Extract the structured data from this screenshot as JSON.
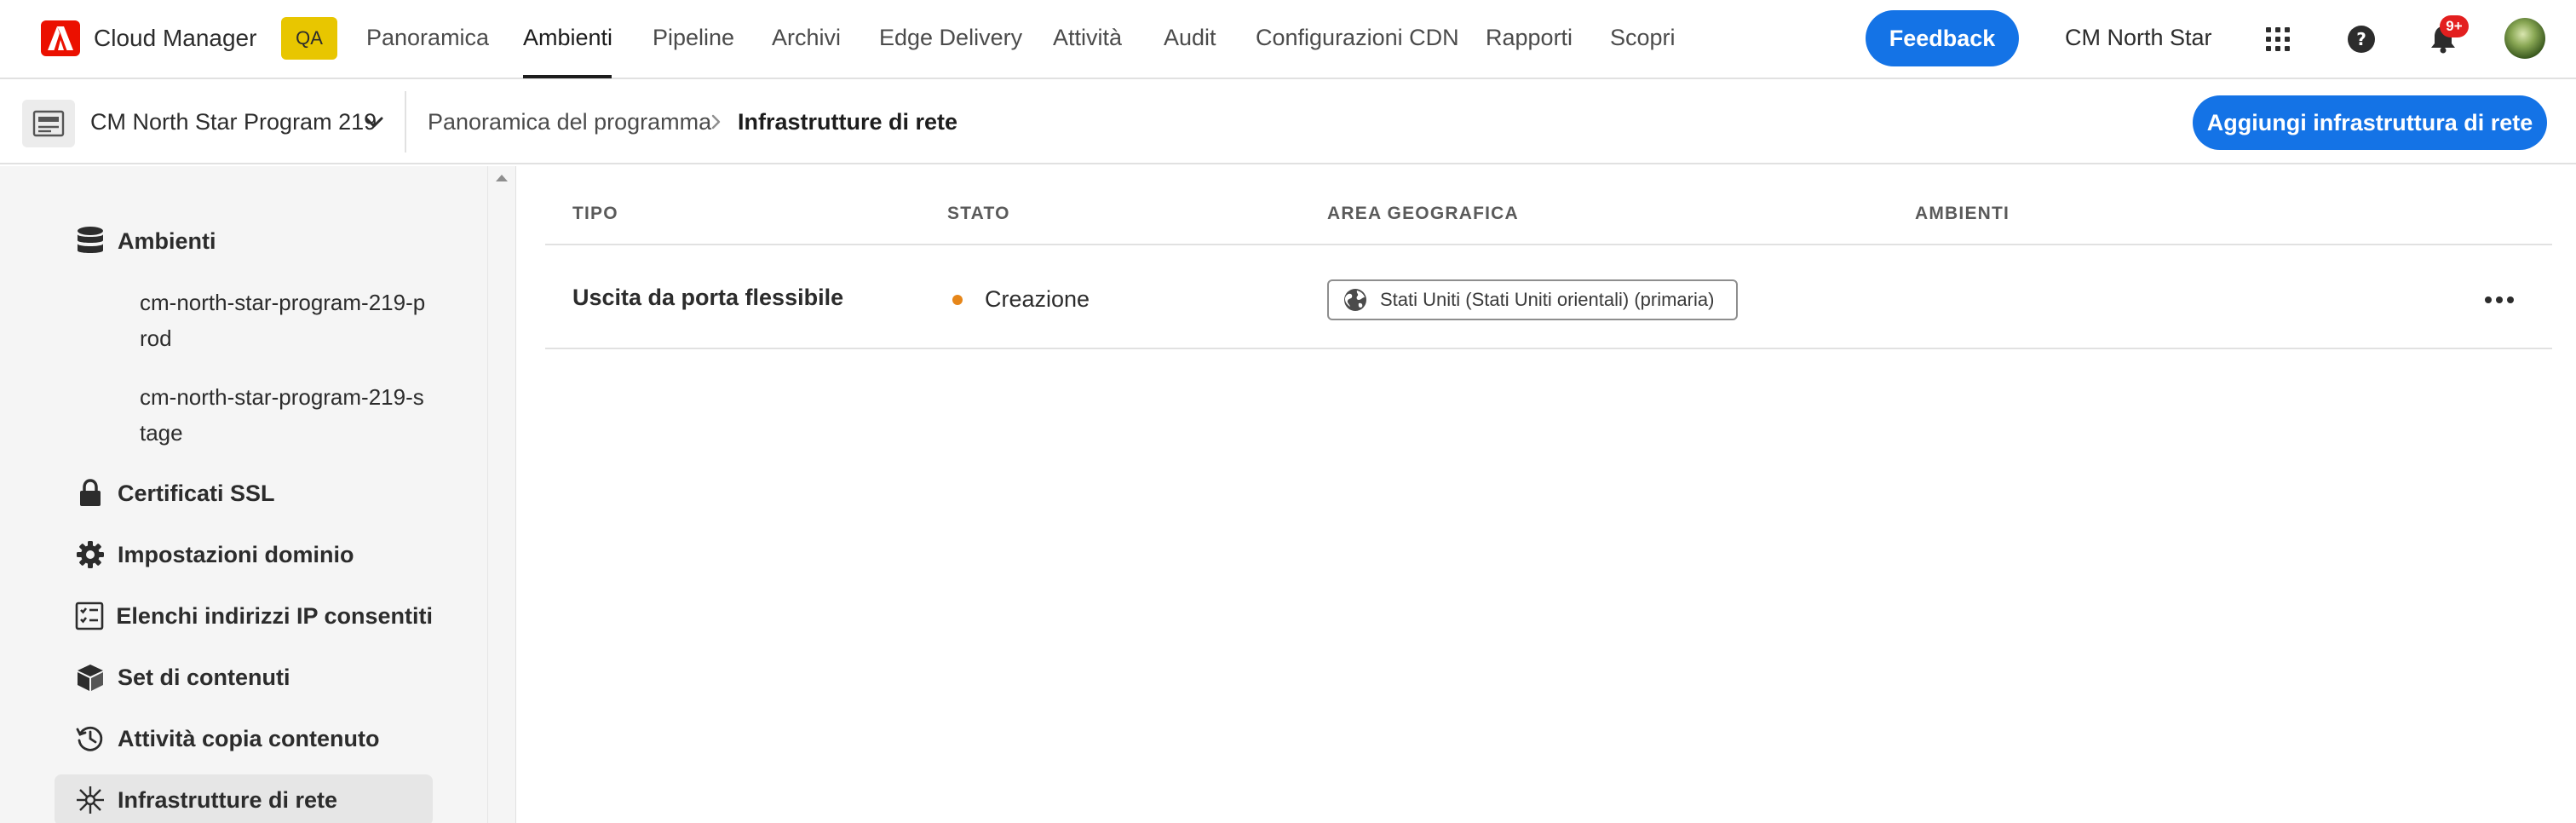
{
  "topnav": {
    "brand": "Cloud Manager",
    "env_badge": "QA",
    "items": [
      {
        "label": "Panoramica"
      },
      {
        "label": "Ambienti",
        "active": true
      },
      {
        "label": "Pipeline"
      },
      {
        "label": "Archivi"
      },
      {
        "label": "Edge Delivery"
      },
      {
        "label": "Attività"
      },
      {
        "label": "Audit"
      },
      {
        "label": "Configurazioni CDN"
      },
      {
        "label": "Rapporti"
      },
      {
        "label": "Scopri"
      }
    ],
    "feedback_label": "Feedback",
    "org_name": "CM North Star",
    "notification_count": "9+",
    "icons": [
      "adobe-logo",
      "app-switcher-icon",
      "help-icon",
      "bell-icon",
      "avatar"
    ]
  },
  "subheader": {
    "program_name": "CM North Star Program 219",
    "breadcrumb": [
      "Panoramica del programma",
      "Infrastrutture di rete"
    ],
    "add_button_label": "Aggiungi infrastruttura di rete"
  },
  "sidebar": {
    "environments_label": "Ambienti",
    "environments": [
      "cm-north-star-program-219-prod",
      "cm-north-star-program-219-stage"
    ],
    "items": [
      {
        "label": "Certificati SSL",
        "icon": "lock-icon"
      },
      {
        "label": "Impostazioni dominio",
        "icon": "gear-icon"
      },
      {
        "label": "Elenchi indirizzi IP consentiti",
        "icon": "checklist-icon"
      },
      {
        "label": "Set di contenuti",
        "icon": "box-icon"
      },
      {
        "label": "Attività copia contenuto",
        "icon": "history-icon"
      },
      {
        "label": "Infrastrutture di rete",
        "icon": "network-icon",
        "selected": true
      }
    ]
  },
  "table": {
    "columns": [
      "TIPO",
      "STATO",
      "AREA GEOGRAFICA",
      "AMBIENTI"
    ],
    "rows": [
      {
        "type": "Uscita da porta flessibile",
        "status": "Creazione",
        "region": "Stati Uniti (Stati Uniti orientali) (primaria)",
        "environments": ""
      }
    ]
  },
  "colors": {
    "accent": "#1473e6",
    "status_creating": "#e68619",
    "adobe_red": "#eb1000",
    "qa_badge": "#e8c600",
    "notification": "#e31f1f"
  }
}
